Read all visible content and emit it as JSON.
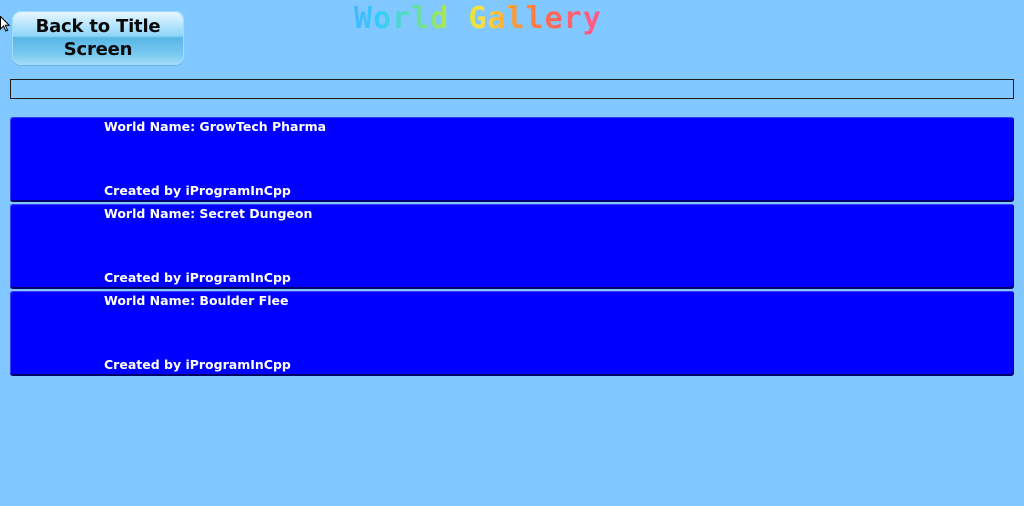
{
  "header": {
    "back_label": "Back to Title Screen",
    "title": "World Gallery"
  },
  "search": {
    "value": ""
  },
  "worlds": [
    {
      "name_text": "World Name: GrowTech Pharma",
      "creator_text": "Created by iProgramInCpp"
    },
    {
      "name_text": "World Name: Secret Dungeon",
      "creator_text": "Created by iProgramInCpp"
    },
    {
      "name_text": "World Name: Boulder Flee",
      "creator_text": "Created by iProgramInCpp"
    }
  ],
  "colors": {
    "background": "#80c8ff",
    "card": "#0000ff",
    "card_text": "#ffffff"
  },
  "icons": [
    "mouse-pointer-icon"
  ]
}
